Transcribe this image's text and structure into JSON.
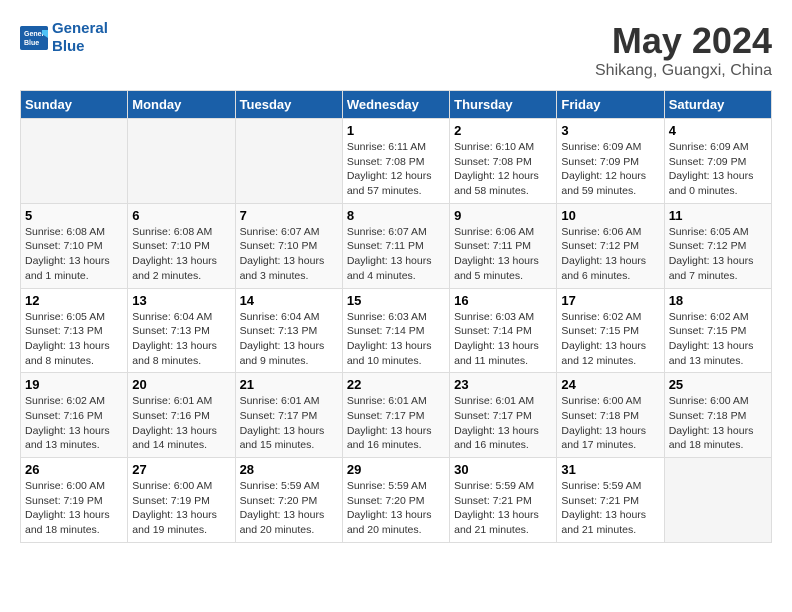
{
  "logo": {
    "line1": "General",
    "line2": "Blue"
  },
  "title": "May 2024",
  "subtitle": "Shikang, Guangxi, China",
  "days_of_week": [
    "Sunday",
    "Monday",
    "Tuesday",
    "Wednesday",
    "Thursday",
    "Friday",
    "Saturday"
  ],
  "weeks": [
    [
      {
        "day": "",
        "info": ""
      },
      {
        "day": "",
        "info": ""
      },
      {
        "day": "",
        "info": ""
      },
      {
        "day": "1",
        "info": "Sunrise: 6:11 AM\nSunset: 7:08 PM\nDaylight: 12 hours and 57 minutes."
      },
      {
        "day": "2",
        "info": "Sunrise: 6:10 AM\nSunset: 7:08 PM\nDaylight: 12 hours and 58 minutes."
      },
      {
        "day": "3",
        "info": "Sunrise: 6:09 AM\nSunset: 7:09 PM\nDaylight: 12 hours and 59 minutes."
      },
      {
        "day": "4",
        "info": "Sunrise: 6:09 AM\nSunset: 7:09 PM\nDaylight: 13 hours and 0 minutes."
      }
    ],
    [
      {
        "day": "5",
        "info": "Sunrise: 6:08 AM\nSunset: 7:10 PM\nDaylight: 13 hours and 1 minute."
      },
      {
        "day": "6",
        "info": "Sunrise: 6:08 AM\nSunset: 7:10 PM\nDaylight: 13 hours and 2 minutes."
      },
      {
        "day": "7",
        "info": "Sunrise: 6:07 AM\nSunset: 7:10 PM\nDaylight: 13 hours and 3 minutes."
      },
      {
        "day": "8",
        "info": "Sunrise: 6:07 AM\nSunset: 7:11 PM\nDaylight: 13 hours and 4 minutes."
      },
      {
        "day": "9",
        "info": "Sunrise: 6:06 AM\nSunset: 7:11 PM\nDaylight: 13 hours and 5 minutes."
      },
      {
        "day": "10",
        "info": "Sunrise: 6:06 AM\nSunset: 7:12 PM\nDaylight: 13 hours and 6 minutes."
      },
      {
        "day": "11",
        "info": "Sunrise: 6:05 AM\nSunset: 7:12 PM\nDaylight: 13 hours and 7 minutes."
      }
    ],
    [
      {
        "day": "12",
        "info": "Sunrise: 6:05 AM\nSunset: 7:13 PM\nDaylight: 13 hours and 8 minutes."
      },
      {
        "day": "13",
        "info": "Sunrise: 6:04 AM\nSunset: 7:13 PM\nDaylight: 13 hours and 8 minutes."
      },
      {
        "day": "14",
        "info": "Sunrise: 6:04 AM\nSunset: 7:13 PM\nDaylight: 13 hours and 9 minutes."
      },
      {
        "day": "15",
        "info": "Sunrise: 6:03 AM\nSunset: 7:14 PM\nDaylight: 13 hours and 10 minutes."
      },
      {
        "day": "16",
        "info": "Sunrise: 6:03 AM\nSunset: 7:14 PM\nDaylight: 13 hours and 11 minutes."
      },
      {
        "day": "17",
        "info": "Sunrise: 6:02 AM\nSunset: 7:15 PM\nDaylight: 13 hours and 12 minutes."
      },
      {
        "day": "18",
        "info": "Sunrise: 6:02 AM\nSunset: 7:15 PM\nDaylight: 13 hours and 13 minutes."
      }
    ],
    [
      {
        "day": "19",
        "info": "Sunrise: 6:02 AM\nSunset: 7:16 PM\nDaylight: 13 hours and 13 minutes."
      },
      {
        "day": "20",
        "info": "Sunrise: 6:01 AM\nSunset: 7:16 PM\nDaylight: 13 hours and 14 minutes."
      },
      {
        "day": "21",
        "info": "Sunrise: 6:01 AM\nSunset: 7:17 PM\nDaylight: 13 hours and 15 minutes."
      },
      {
        "day": "22",
        "info": "Sunrise: 6:01 AM\nSunset: 7:17 PM\nDaylight: 13 hours and 16 minutes."
      },
      {
        "day": "23",
        "info": "Sunrise: 6:01 AM\nSunset: 7:17 PM\nDaylight: 13 hours and 16 minutes."
      },
      {
        "day": "24",
        "info": "Sunrise: 6:00 AM\nSunset: 7:18 PM\nDaylight: 13 hours and 17 minutes."
      },
      {
        "day": "25",
        "info": "Sunrise: 6:00 AM\nSunset: 7:18 PM\nDaylight: 13 hours and 18 minutes."
      }
    ],
    [
      {
        "day": "26",
        "info": "Sunrise: 6:00 AM\nSunset: 7:19 PM\nDaylight: 13 hours and 18 minutes."
      },
      {
        "day": "27",
        "info": "Sunrise: 6:00 AM\nSunset: 7:19 PM\nDaylight: 13 hours and 19 minutes."
      },
      {
        "day": "28",
        "info": "Sunrise: 5:59 AM\nSunset: 7:20 PM\nDaylight: 13 hours and 20 minutes."
      },
      {
        "day": "29",
        "info": "Sunrise: 5:59 AM\nSunset: 7:20 PM\nDaylight: 13 hours and 20 minutes."
      },
      {
        "day": "30",
        "info": "Sunrise: 5:59 AM\nSunset: 7:21 PM\nDaylight: 13 hours and 21 minutes."
      },
      {
        "day": "31",
        "info": "Sunrise: 5:59 AM\nSunset: 7:21 PM\nDaylight: 13 hours and 21 minutes."
      },
      {
        "day": "",
        "info": ""
      }
    ]
  ]
}
